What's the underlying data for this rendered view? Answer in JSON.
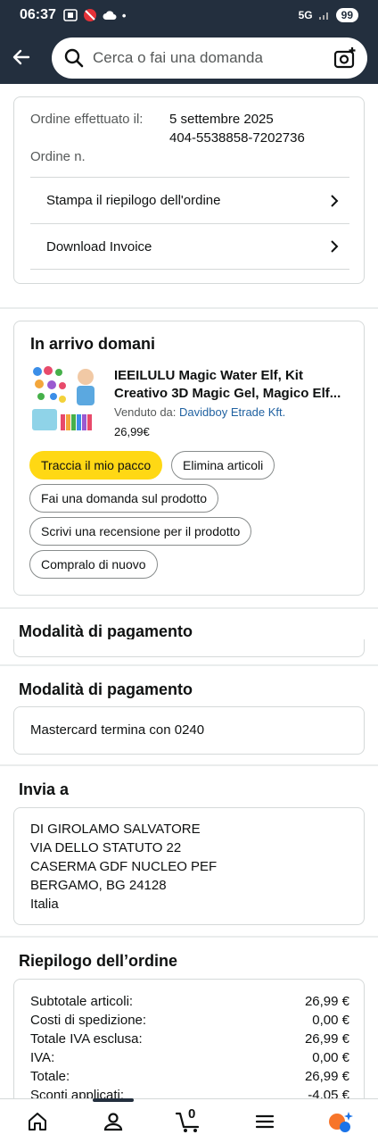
{
  "status": {
    "time": "06:37",
    "network": "5G",
    "battery": "99"
  },
  "search": {
    "placeholder": "Cerca o fai una domanda"
  },
  "order_info": {
    "date_label": "Ordine effettuato il:",
    "date_value": "5 settembre 2025",
    "number_label": "Ordine n.",
    "number_value": "404-5538858-7202736",
    "links": [
      {
        "label": "Stampa il riepilogo dell'ordine"
      },
      {
        "label": "Download Invoice"
      }
    ]
  },
  "shipment": {
    "title": "In arrivo domani",
    "product": {
      "title": "IEEILULU Magic Water Elf, Kit Creativo 3D Magic Gel, Magico Elf...",
      "sold_by_label": "Venduto da:",
      "sold_by": "Davidboy Etrade Kft.",
      "price": "26,99€"
    },
    "actions": {
      "track": "Traccia il mio pacco",
      "delete": "Elimina articoli",
      "ask": "Fai una domanda sul prodotto",
      "review": "Scrivi una recensione per il prodotto",
      "buy_again": "Compralo di nuovo"
    }
  },
  "payment_collapsed": {
    "title": "Modalità di pagamento"
  },
  "payment": {
    "title": "Modalità di pagamento",
    "method": "Mastercard  termina con 0240"
  },
  "shipping": {
    "title": "Invia a",
    "lines": [
      "DI GIROLAMO SALVATORE",
      "VIA DELLO STATUTO 22",
      "CASERMA GDF NUCLEO PEF",
      "BERGAMO, BG 24128",
      "Italia"
    ]
  },
  "summary": {
    "title": "Riepilogo dell’ordine",
    "rows": [
      {
        "label": "Subtotale articoli:",
        "value": "26,99 €"
      },
      {
        "label": "Costi di spedizione:",
        "value": "0,00 €"
      },
      {
        "label": "Totale IVA esclusa:",
        "value": "26,99 €"
      },
      {
        "label": "IVA:",
        "value": "0,00 €"
      },
      {
        "label": "Totale:",
        "value": "26,99 €"
      },
      {
        "label": "Sconti applicati:",
        "value": "-4,05 €"
      }
    ]
  },
  "bottom_nav": {
    "cart_count": "0"
  },
  "colors": {
    "header_bg": "#232f3e",
    "primary_button": "#ffd814",
    "link": "#2162a1",
    "divider": "#d5d9d9"
  }
}
